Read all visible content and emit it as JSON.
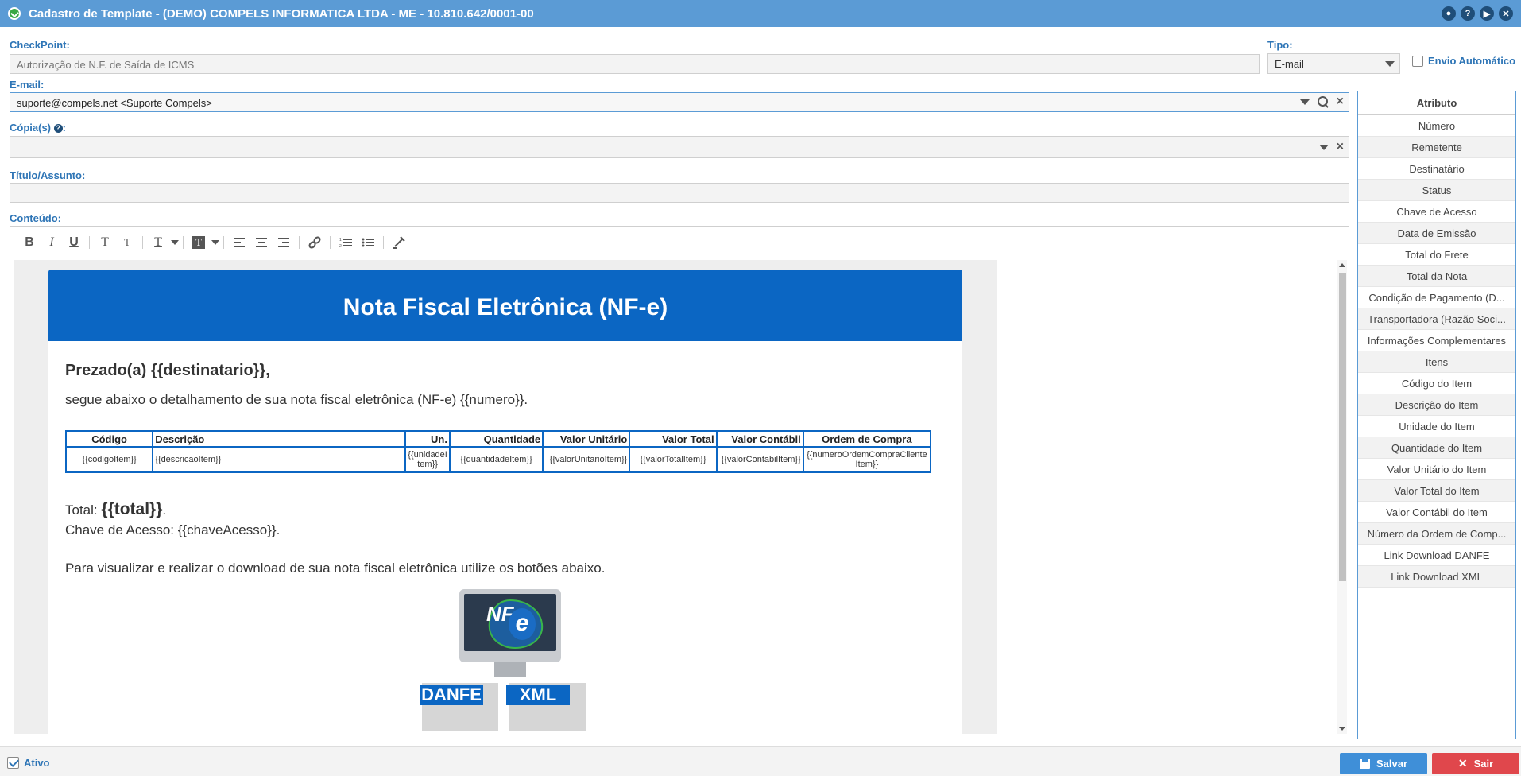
{
  "window": {
    "title": "Cadastro de Template - (DEMO) COMPELS INFORMATICA LTDA - ME - 10.810.642/0001-00",
    "controls": [
      "●",
      "?",
      "▶",
      "✕"
    ]
  },
  "form": {
    "checkpoint_label": "CheckPoint:",
    "checkpoint_value": "Autorização de N.F. de Saída de ICMS",
    "tipo_label": "Tipo:",
    "tipo_value": "E-mail",
    "envio_label": "Envio Automático",
    "envio_checked": false,
    "email_label": "E-mail:",
    "email_value": "suporte@compels.net <Suporte Compels>",
    "copias_label": "Cópia(s)",
    "copias_value": "",
    "titulo_label": "Título/Assunto:",
    "titulo_value": "",
    "conteudo_label": "Conteúdo:"
  },
  "toolbar": {
    "bold": "B",
    "italic": "I",
    "underline": "U",
    "superscript": "T",
    "subscript": "T",
    "font_color": "T",
    "bg_color": "T"
  },
  "mail": {
    "header": "Nota Fiscal Eletrônica (NF-e)",
    "greeting": "Prezado(a) {{destinatario}},",
    "intro": "segue abaixo o detalhamento de sua nota fiscal eletrônica (NF-e) {{numero}}.",
    "table": {
      "headers": [
        "Código",
        "Descrição",
        "Un.",
        "Quantidade",
        "Valor Unitário",
        "Valor Total",
        "Valor Contábil",
        "Ordem de Compra"
      ],
      "row": [
        "{{codigoItem}}",
        "{{descricaoItem}}",
        "{{unidadeItem}}",
        "{{quantidadeItem}}",
        "{{valorUnitarioItem}}",
        "{{valorTotalItem}}",
        "{{valorContabilItem}}",
        "{{numeroOrdemCompraClienteItem}}"
      ]
    },
    "total_prefix": "Total: ",
    "total_value": "{{total}}",
    "total_suffix": ".",
    "chave": "Chave de Acesso: {{chaveAcesso}}.",
    "view_text": "Para visualizar e realizar o download de sua nota fiscal eletrônica utilize os botões abaixo.",
    "logo_nf": "NF",
    "logo_e": "e",
    "danfe_label": "DANFE",
    "xml_label": "XML"
  },
  "attributes": {
    "header": "Atributo",
    "items": [
      "Número",
      "Remetente",
      "Destinatário",
      "Status",
      "Chave de Acesso",
      "Data de Emissão",
      "Total do Frete",
      "Total da Nota",
      "Condição de Pagamento (D...",
      "Transportadora (Razão Soci...",
      "Informações Complementares",
      "Itens",
      "Código do Item",
      "Descrição do Item",
      "Unidade do Item",
      "Quantidade do Item",
      "Valor Unitário do Item",
      "Valor Total do Item",
      "Valor Contábil do Item",
      "Número da Ordem de Comp...",
      "Link Download DANFE",
      "Link Download XML"
    ]
  },
  "footer": {
    "ativo_label": "Ativo",
    "ativo_checked": true,
    "save_label": "Salvar",
    "exit_label": "Sair"
  },
  "colors": {
    "titlebar": "#5b9bd5",
    "accent": "#2e75b6",
    "mail_header": "#0b66c3",
    "save": "#3f8fd8",
    "exit": "#e0474c"
  }
}
